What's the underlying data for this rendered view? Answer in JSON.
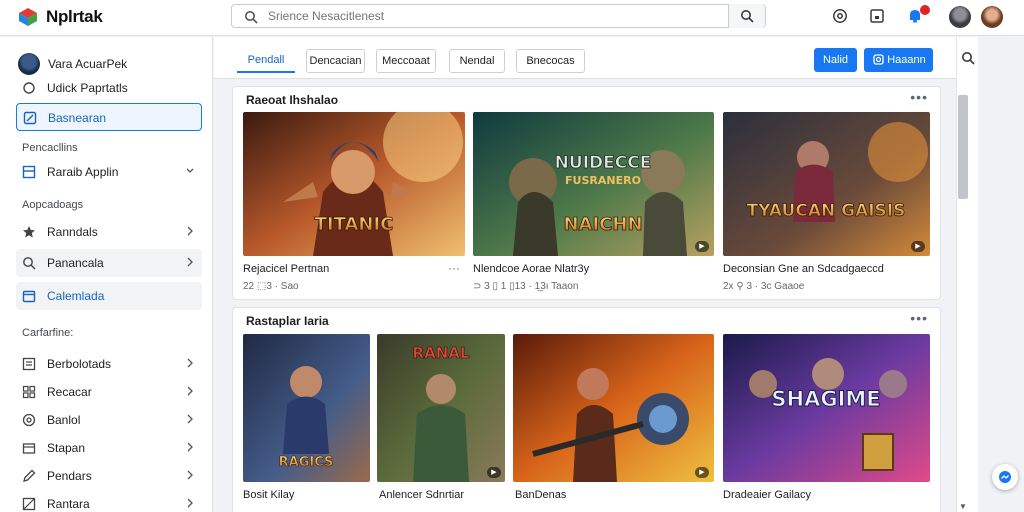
{
  "app": {
    "name": "Nplrtak"
  },
  "search": {
    "placeholder": "Srience Nesacitlenest"
  },
  "colors": {
    "accent": "#1877f2",
    "notification": "#e02424"
  },
  "topbar_icons": [
    "logo-icon",
    "search-icon",
    "location-icon",
    "square-icon",
    "bell-icon"
  ],
  "sidebar": {
    "user_name": "Vara AcuarPek",
    "top_items": [
      {
        "label": "Udick Paprtatls",
        "icon": "circle-icon"
      },
      {
        "label": "Basnearan",
        "icon": "edit-icon",
        "state": "active"
      }
    ],
    "section1_label": "Pencacllins",
    "section1_items": [
      {
        "label": "Raraib Applin",
        "icon": "grid-icon",
        "chevron": "down"
      }
    ],
    "section2_label": "Aopcadoags",
    "section2_items": [
      {
        "label": "Ranndals",
        "icon": "star-icon",
        "chevron": "right"
      },
      {
        "label": "Panancala",
        "icon": "search-icon",
        "chevron": "right",
        "state": "highlight"
      },
      {
        "label": "Calemlada",
        "icon": "calendar-icon",
        "state": "link"
      }
    ],
    "section3_label": "Carfarfine:",
    "section3_items": [
      {
        "label": "Berbolotads",
        "icon": "list-icon",
        "chevron": "right"
      },
      {
        "label": "Recacar",
        "icon": "grid-icon",
        "chevron": "right"
      },
      {
        "label": "Banlol",
        "icon": "target-icon",
        "chevron": "right"
      },
      {
        "label": "Stapan",
        "icon": "box-icon",
        "chevron": "right"
      },
      {
        "label": "Pendars",
        "icon": "pen-icon",
        "chevron": "right"
      },
      {
        "label": "Rantara",
        "icon": "flag-icon",
        "chevron": "right"
      }
    ]
  },
  "tabs": [
    {
      "label": "Pendall",
      "active": true
    },
    {
      "label": "Dencacian"
    },
    {
      "label": "Meccoaat"
    },
    {
      "label": "Nendal"
    },
    {
      "label": "Bnecocas"
    }
  ],
  "actions": {
    "primary_label": "Nalid",
    "secondary_label": "Haaann"
  },
  "sections": [
    {
      "title": "Raeoat Ihshalao",
      "games": [
        {
          "title": "Rejacicel Pertnan",
          "stats": "22  ⬚3 · Sao",
          "art_text": "TITANIC",
          "palette": "warm"
        },
        {
          "title": "Nlendcoe Aorae Nlatr3y",
          "stats": "⊃ 3  ▯ 1 ▯13 · 1̲3ı Taaon",
          "art_text": "NAICHN",
          "overlay_text": "NUIDECCE",
          "overlay_sub": "FUSRANERO",
          "palette": "green"
        },
        {
          "title": "Deconsian Gne an Sdcadgaeccd",
          "stats": "2x  ⚲ 3 · 3c Gaaoe",
          "art_text": "TYAUCAN GAISIS",
          "palette": "dark"
        }
      ]
    },
    {
      "title": "Rastaplar Iaria",
      "games": [
        {
          "title": "Bosit Kilay",
          "stats": "",
          "art_text": "RAGICS",
          "palette": "blue"
        },
        {
          "title": "Anlencer Sdnrtiar",
          "stats": "",
          "art_text": "RANAL",
          "palette": "olive"
        },
        {
          "title": "BanDenas",
          "stats": "",
          "art_text": "",
          "palette": "fire"
        },
        {
          "title": "Dradeaier Gailacy",
          "stats": "",
          "art_text": "SHAGIME",
          "palette": "neon"
        }
      ]
    }
  ]
}
